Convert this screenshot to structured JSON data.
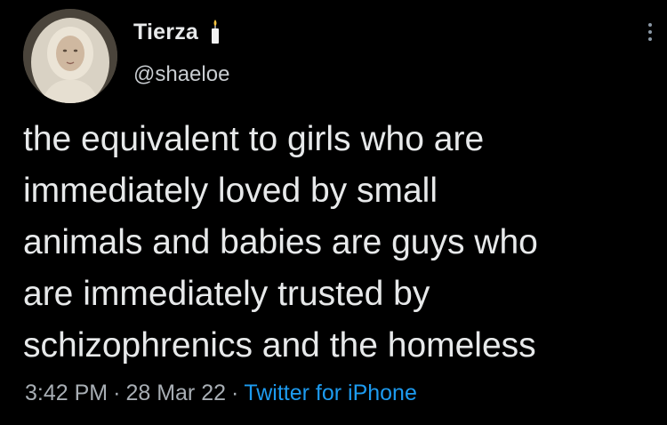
{
  "tweet": {
    "display_name": "Tierza",
    "handle": "@shaeloe",
    "name_emoji_icon": "candle-icon",
    "text": "the equivalent to girls who are\nimmediately loved by small\nanimals and babies are guys who\nare immediately trusted by\nschizophrenics and the homeless",
    "time": "3:42 PM",
    "date": "28 Mar 22",
    "source": "Twitter for iPhone",
    "separator": "·"
  },
  "colors": {
    "background": "#000000",
    "text": "#e7e9ea",
    "secondary_text": "#a8aeb4",
    "link": "#1d9bf0"
  }
}
